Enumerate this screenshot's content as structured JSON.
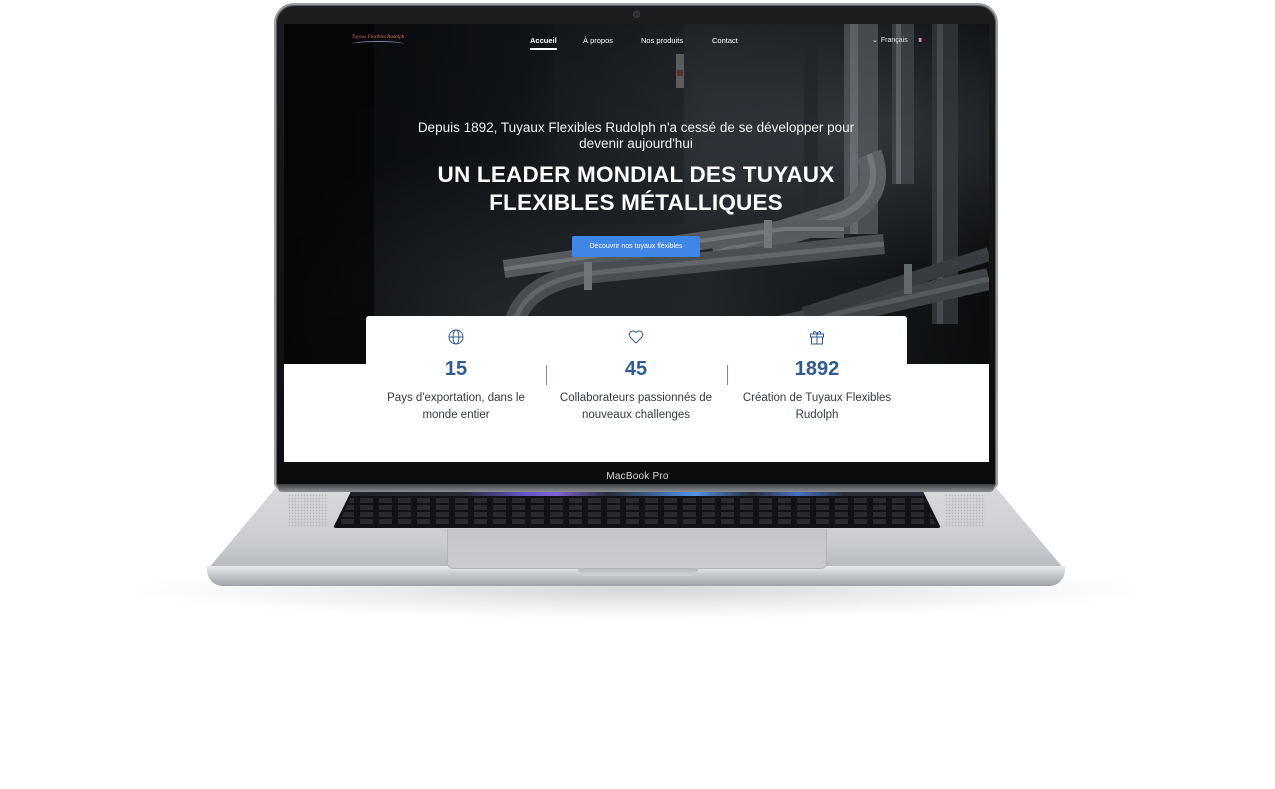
{
  "device": {
    "label": "MacBook Pro"
  },
  "nav": {
    "logo_text": "Tuyaux Flexibles Rudolph",
    "links": [
      {
        "label": "Accueil",
        "active": true
      },
      {
        "label": "À propos",
        "active": false
      },
      {
        "label": "Nos produits",
        "active": false
      },
      {
        "label": "Contact",
        "active": false
      }
    ],
    "language": "Français"
  },
  "hero": {
    "subtitle": "Depuis 1892, Tuyaux Flexibles Rudolph n'a cessé de se développer pour devenir aujourd'hui",
    "title": "UN LEADER MONDIAL DES TUYAUX FLEXIBLES MÉTALLIQUES",
    "cta_label": "Découvrir nos tuyaux fléxibles",
    "cta_color": "#3f86e6"
  },
  "stats": [
    {
      "icon": "globe-icon",
      "value": "15",
      "label": "Pays d'exportation, dans le monde entier"
    },
    {
      "icon": "heart-icon",
      "value": "45",
      "label": "Collaborateurs passionnés de nouveaux challenges"
    },
    {
      "icon": "gift-icon",
      "value": "1892",
      "label": "Création de Tuyaux Flexibles Rudolph"
    }
  ],
  "colors": {
    "accent": "#2f5a92",
    "button": "#3f86e6"
  }
}
